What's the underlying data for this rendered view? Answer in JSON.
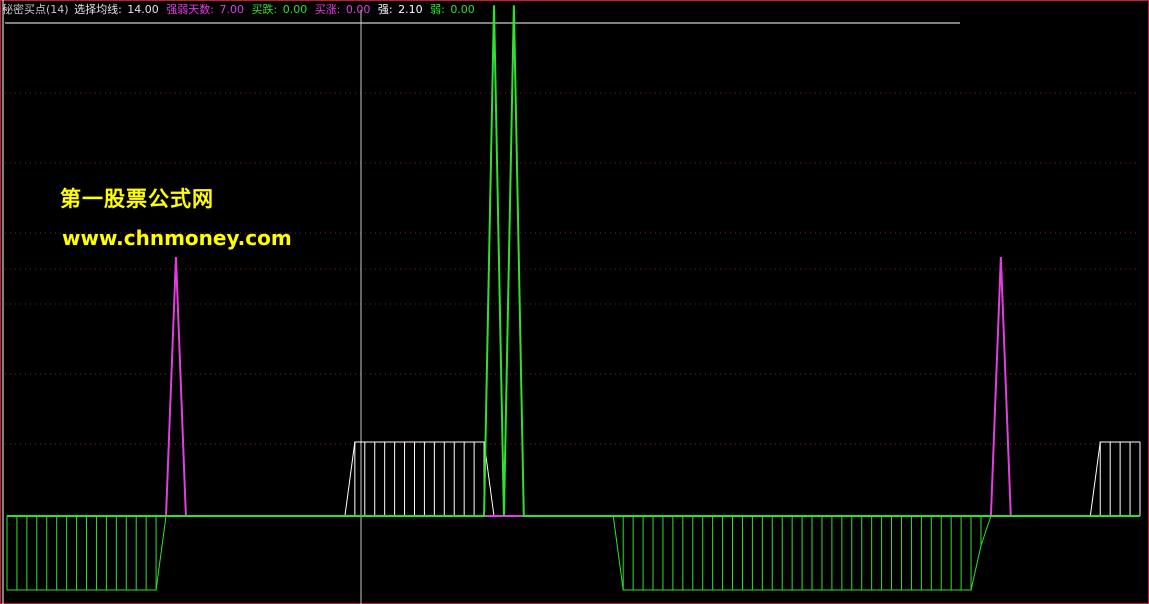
{
  "header": {
    "indicator": {
      "label": "秘密买点(14)",
      "color": "#c8c8c8"
    },
    "items": [
      {
        "label": "选择均线: ",
        "value": "14.00",
        "color": "#e6e6e6"
      },
      {
        "label": "强弱天数: ",
        "value": "7.00",
        "color": "#e23ee2"
      },
      {
        "label": "买跌: ",
        "value": "0.00",
        "color": "#30e030"
      },
      {
        "label": "买涨: ",
        "value": "0.00",
        "color": "#e23ee2"
      },
      {
        "label": "强: ",
        "value": "2.10",
        "color": "#ffffff"
      },
      {
        "label": "弱: ",
        "value": "0.00",
        "color": "#30e030"
      }
    ]
  },
  "watermark": {
    "line1": "第一股票公式网",
    "line2": "www.chnmoney.com",
    "color": "#ffff00"
  },
  "colors": {
    "background": "#000000",
    "border": "#c0202a",
    "grid": "#8a2020",
    "crosshair": "#c8c8c8",
    "strong": "#ffffff",
    "weak": "#30e030",
    "buy_up": "#e23ee2",
    "buy_down": "#30e030"
  },
  "chart_data": {
    "type": "line",
    "title": "",
    "xlabel": "",
    "ylabel": "",
    "ylim": [
      -1.05,
      7.0
    ],
    "x_count": 115,
    "grid": "dotted horizontal",
    "legend": "header-top",
    "series": [
      {
        "name": "强",
        "style": "step-histogram-up",
        "color": "#ffffff",
        "values": [
          0,
          0,
          0,
          0,
          0,
          0,
          0,
          0,
          0,
          0,
          0,
          0,
          0,
          0,
          0,
          0,
          0,
          0,
          0,
          0,
          0,
          0,
          0,
          0,
          0,
          0,
          0,
          0,
          0,
          0,
          0,
          0,
          0,
          0,
          0,
          1,
          1,
          1,
          1,
          1,
          1,
          1,
          1,
          1,
          1,
          1,
          1,
          1,
          1,
          0,
          0,
          0,
          0,
          0,
          0,
          0,
          0,
          0,
          0,
          0,
          0,
          0,
          0,
          0,
          0,
          0,
          0,
          0,
          0,
          0,
          0,
          0,
          0,
          0,
          0,
          0,
          0,
          0,
          0,
          0,
          0,
          0,
          0,
          0,
          0,
          0,
          0,
          0,
          0,
          0,
          0,
          0,
          0,
          0,
          0,
          0,
          0,
          0,
          0,
          0,
          0,
          0,
          0,
          0,
          0,
          0,
          0,
          0,
          0,
          0,
          1,
          1,
          1,
          1,
          1
        ]
      },
      {
        "name": "弱",
        "style": "step-histogram-down",
        "color": "#30e030",
        "values": [
          1,
          1,
          1,
          1,
          1,
          1,
          1,
          1,
          1,
          1,
          1,
          1,
          1,
          1,
          1,
          1,
          0,
          0,
          0,
          0,
          0,
          0,
          0,
          0,
          0,
          0,
          0,
          0,
          0,
          0,
          0,
          0,
          0,
          0,
          0,
          0,
          0,
          0,
          0,
          0,
          0,
          0,
          0,
          0,
          0,
          0,
          0,
          0,
          0,
          0,
          0,
          0,
          0,
          0,
          0,
          0,
          0,
          0,
          0,
          0,
          0,
          0,
          1,
          1,
          1,
          1,
          1,
          1,
          1,
          1,
          1,
          1,
          1,
          1,
          1,
          1,
          1,
          1,
          1,
          1,
          1,
          1,
          1,
          1,
          1,
          1,
          1,
          1,
          1,
          1,
          1,
          1,
          1,
          1,
          1,
          1,
          1,
          1,
          0.4,
          0,
          0,
          0,
          0,
          0,
          0,
          0,
          0,
          0,
          0,
          0,
          0,
          0,
          0,
          0,
          0
        ]
      },
      {
        "name": "买涨",
        "style": "line",
        "color": "#e23ee2",
        "values": [
          0,
          0,
          0,
          0,
          0,
          0,
          0,
          0,
          0,
          0,
          0,
          0,
          0,
          0,
          0,
          0,
          0,
          3.5,
          0,
          0,
          0,
          0,
          0,
          0,
          0,
          0,
          0,
          0,
          0,
          0,
          0,
          0,
          0,
          0,
          0,
          0,
          0,
          0,
          0,
          0,
          0,
          0,
          0,
          0,
          0,
          0,
          0,
          0,
          0,
          0,
          0,
          0,
          0,
          0,
          0,
          0,
          0,
          0,
          0,
          0,
          0,
          0,
          0,
          0,
          0,
          0,
          0,
          0,
          0,
          0,
          0,
          0,
          0,
          0,
          0,
          0,
          0,
          0,
          0,
          0,
          0,
          0,
          0,
          0,
          0,
          0,
          0,
          0,
          0,
          0,
          0,
          0,
          0,
          0,
          0,
          0,
          0,
          0,
          0,
          0,
          3.5,
          0,
          0,
          0,
          0,
          0,
          0,
          0,
          0,
          0,
          0,
          0,
          0,
          0,
          0
        ]
      },
      {
        "name": "买跌",
        "style": "line",
        "color": "#30e030",
        "values": [
          0,
          0,
          0,
          0,
          0,
          0,
          0,
          0,
          0,
          0,
          0,
          0,
          0,
          0,
          0,
          0,
          0,
          0,
          0,
          0,
          0,
          0,
          0,
          0,
          0,
          0,
          0,
          0,
          0,
          0,
          0,
          0,
          0,
          0,
          0,
          0,
          0,
          0,
          0,
          0,
          0,
          0,
          0,
          0,
          0,
          0,
          0,
          0,
          0,
          6.9,
          0,
          6.9,
          0,
          0,
          0,
          0,
          0,
          0,
          0,
          0,
          0,
          0,
          0,
          0,
          0,
          0,
          0,
          0,
          0,
          0,
          0,
          0,
          0,
          0,
          0,
          0,
          0,
          0,
          0,
          0,
          0,
          0,
          0,
          0,
          0,
          0,
          0,
          0,
          0,
          0,
          0,
          0,
          0,
          0,
          0,
          0,
          0,
          0,
          0,
          0,
          0,
          0,
          0,
          0,
          0,
          0,
          0,
          0,
          0,
          0,
          0,
          0,
          0,
          0,
          0
        ]
      }
    ]
  }
}
